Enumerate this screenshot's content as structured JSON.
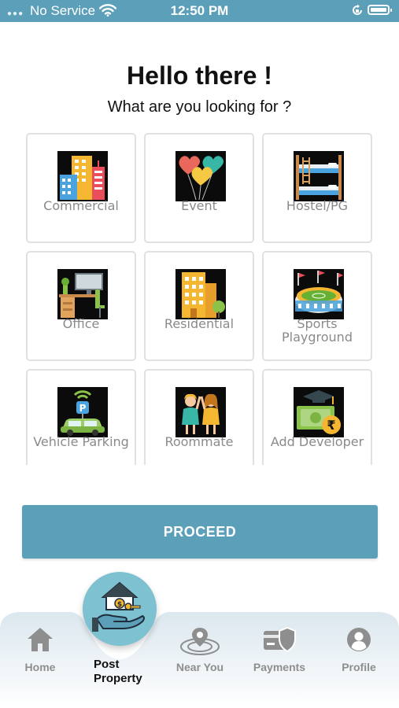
{
  "status_bar": {
    "carrier": "No Service",
    "time": "12:50 PM"
  },
  "header": {
    "title": "Hello there !",
    "subtitle": "What are you looking for ?"
  },
  "categories": [
    {
      "label": "Commercial",
      "icon": "commercial-buildings-icon"
    },
    {
      "label": "Event",
      "icon": "balloons-icon"
    },
    {
      "label": "Hostel/PG",
      "icon": "bunk-bed-icon"
    },
    {
      "label": "Office",
      "icon": "office-desk-icon"
    },
    {
      "label": "Residential",
      "icon": "residential-building-icon"
    },
    {
      "label": "Sports Playground",
      "icon": "stadium-icon"
    },
    {
      "label": "Vehicle Parking",
      "icon": "car-parking-icon"
    },
    {
      "label": "Roommate",
      "icon": "roommates-icon"
    },
    {
      "label": "Add Developer",
      "icon": "graduation-money-icon"
    }
  ],
  "proceed_label": "PROCEED",
  "bottom_nav": {
    "home": "Home",
    "post_property": "Post Property",
    "near_you": "Near You",
    "payments": "Payments",
    "profile": "Profile"
  },
  "colors": {
    "accent": "#5c9fb9",
    "post_circle": "#7ec1d0",
    "tile_border": "#e1e1e1",
    "label_gray": "#8a8a8a"
  }
}
